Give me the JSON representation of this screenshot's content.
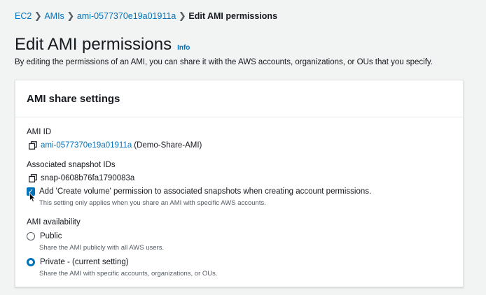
{
  "breadcrumb": {
    "items": [
      "EC2",
      "AMIs",
      "ami-0577370e19a01911a"
    ],
    "current": "Edit AMI permissions",
    "separator": "❯"
  },
  "page": {
    "title": "Edit AMI permissions",
    "info": "Info",
    "description": "By editing the permissions of an AMI, you can share it with the AWS accounts, organizations, or OUs that you specify."
  },
  "panel": {
    "title": "AMI share settings",
    "ami_id": {
      "label": "AMI ID",
      "link": "ami-0577370e19a01911a",
      "suffix": "(Demo-Share-AMI)"
    },
    "snapshots": {
      "label": "Associated snapshot IDs",
      "value": "snap-0608b76fa1790083a"
    },
    "create_volume": {
      "checked": true,
      "label": "Add 'Create volume' permission to associated snapshots when creating account permissions.",
      "hint": "This setting only applies when you share an AMI with specific AWS accounts."
    },
    "availability": {
      "label": "AMI availability",
      "options": [
        {
          "label": "Public",
          "hint": "Share the AMI publicly with all AWS users.",
          "selected": false
        },
        {
          "label": "Private - (current setting)",
          "hint": "Share the AMI with specific accounts, organizations, or OUs.",
          "selected": true
        }
      ]
    }
  },
  "colors": {
    "link": "#0073bb",
    "background": "#f2f3f3",
    "text": "#16191f"
  }
}
